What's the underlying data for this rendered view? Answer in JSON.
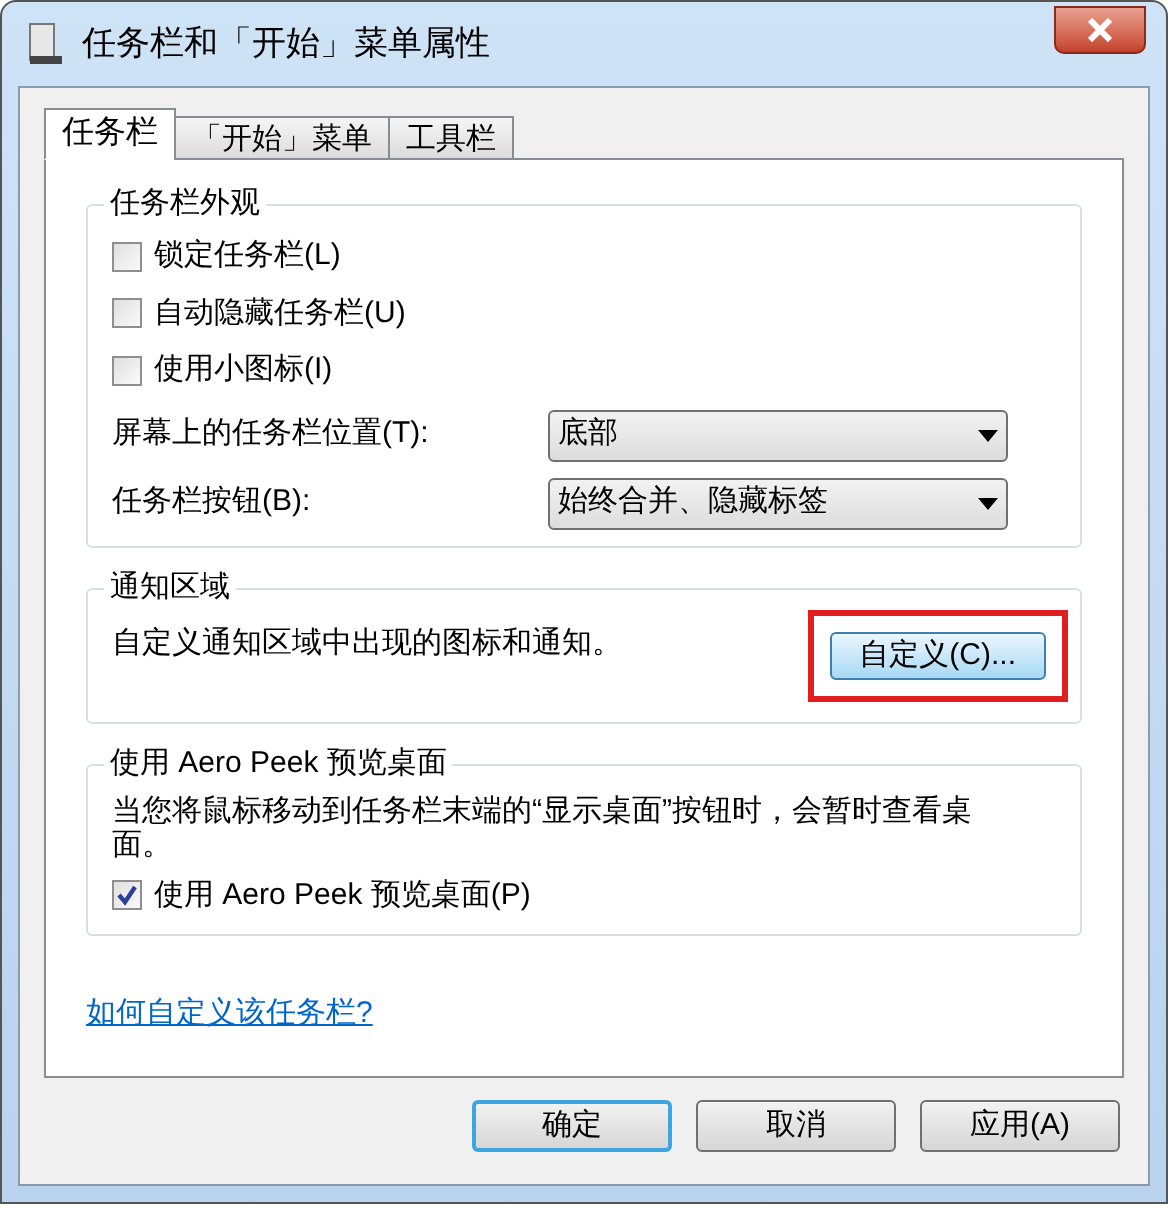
{
  "window": {
    "title": "任务栏和「开始」菜单属性"
  },
  "tabs": [
    {
      "label": "任务栏",
      "selected": true
    },
    {
      "label": "「开始」菜单",
      "selected": false
    },
    {
      "label": "工具栏",
      "selected": false
    }
  ],
  "appearance": {
    "title": "任务栏外观",
    "checkboxes": [
      {
        "label": "锁定任务栏(L)",
        "checked": false
      },
      {
        "label": "自动隐藏任务栏(U)",
        "checked": false
      },
      {
        "label": "使用小图标(I)",
        "checked": false
      }
    ],
    "dropdowns": [
      {
        "label": "屏幕上的任务栏位置(T):",
        "value": "底部"
      },
      {
        "label": "任务栏按钮(B):",
        "value": "始终合并、隐藏标签"
      }
    ]
  },
  "notification_area": {
    "title": "通知区域",
    "text": "自定义通知区域中出现的图标和通知。",
    "button": "自定义(C)...",
    "highlighted": true
  },
  "aero_peek": {
    "title": "使用 Aero Peek 预览桌面",
    "text": "当您将鼠标移动到任务栏末端的“显示桌面”按钮时，会暂时查看桌面。",
    "checkbox": {
      "label": "使用 Aero Peek 预览桌面(P)",
      "checked": true
    }
  },
  "help_link": "如何自定义该任务栏?",
  "buttons": [
    {
      "label": "确定",
      "default": true
    },
    {
      "label": "取消",
      "default": false
    },
    {
      "label": "应用(A)",
      "default": false
    }
  ]
}
